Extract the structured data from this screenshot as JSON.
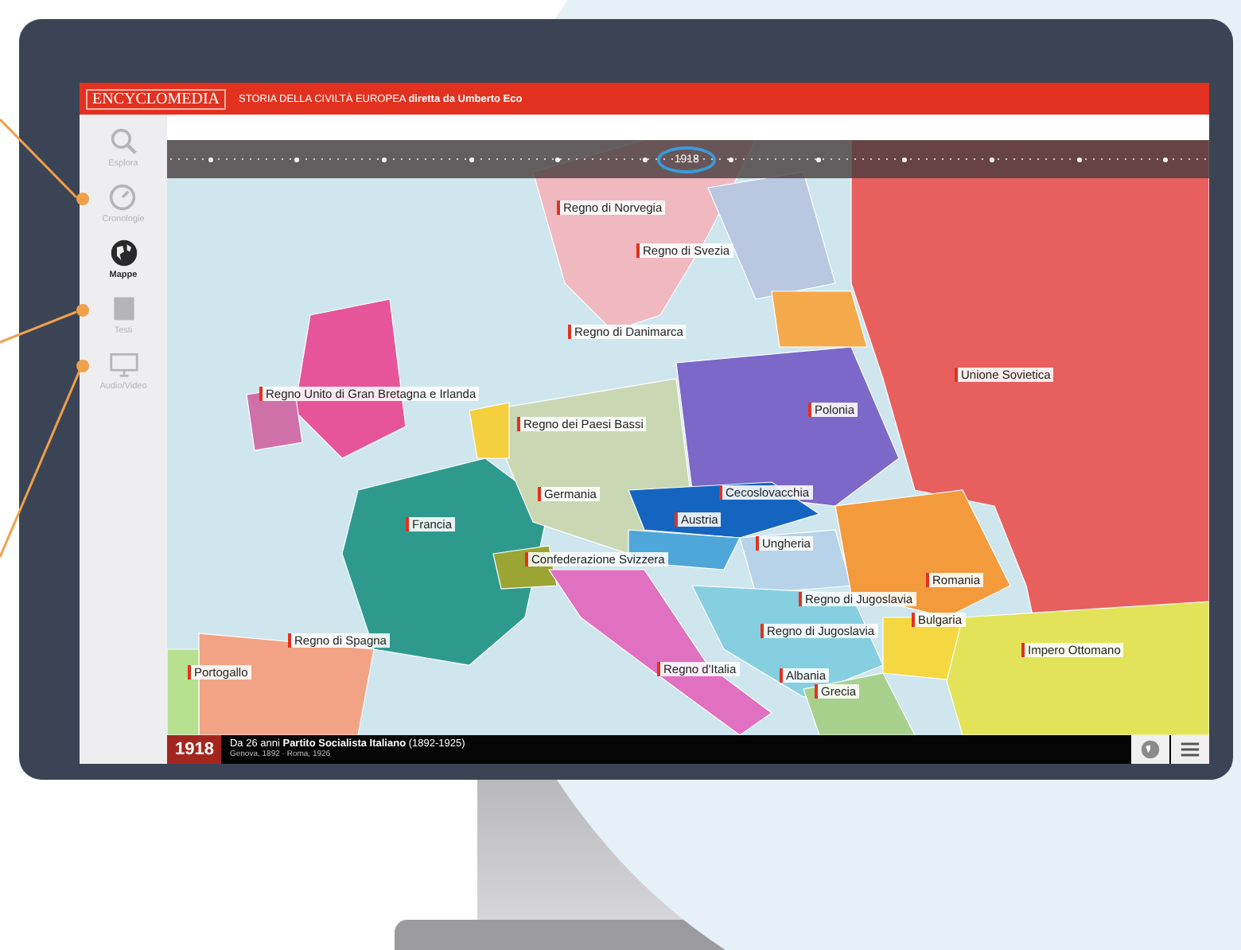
{
  "header": {
    "logo": "ENCYCLOMEDIA",
    "title": "STORIA DELLA CIVILTÀ EUROPEA **diretta da Umberto Eco**"
  },
  "sidebar": {
    "items": [
      {
        "label": "Esplora",
        "selected": false
      },
      {
        "label": "Cronologie",
        "selected": false
      },
      {
        "label": "Mappe",
        "selected": true
      },
      {
        "label": "Testi",
        "selected": false
      },
      {
        "label": "Audio/Video",
        "selected": false
      }
    ]
  },
  "timeline": {
    "current": "1918"
  },
  "map": {
    "labels": [
      "Regno di Norvegia",
      "Regno di Svezia",
      "Regno di Danimarca",
      "Regno Unito di Gran Bretagna e Irlanda",
      "Regno dei Paesi Bassi",
      "Polonia",
      "Unione Sovietica",
      "Germania",
      "Cecoslovacchia",
      "Francia",
      "Austria",
      "Confederazione Svizzera",
      "Ungheria",
      "Romania",
      "Regno di Jugoslavia",
      "Bulgaria",
      "Regno di Spagna",
      "Regno di Jugoslavia",
      "Impero Ottomano",
      "Portogallo",
      "Regno d'Italia",
      "Albania",
      "Grecia"
    ]
  },
  "footer": {
    "year": "1918",
    "headline": "Da 26 anni **Partito Socialista Italiano** (1892-1925)",
    "subline": "Genova, 1892 · Roma, 1926"
  }
}
